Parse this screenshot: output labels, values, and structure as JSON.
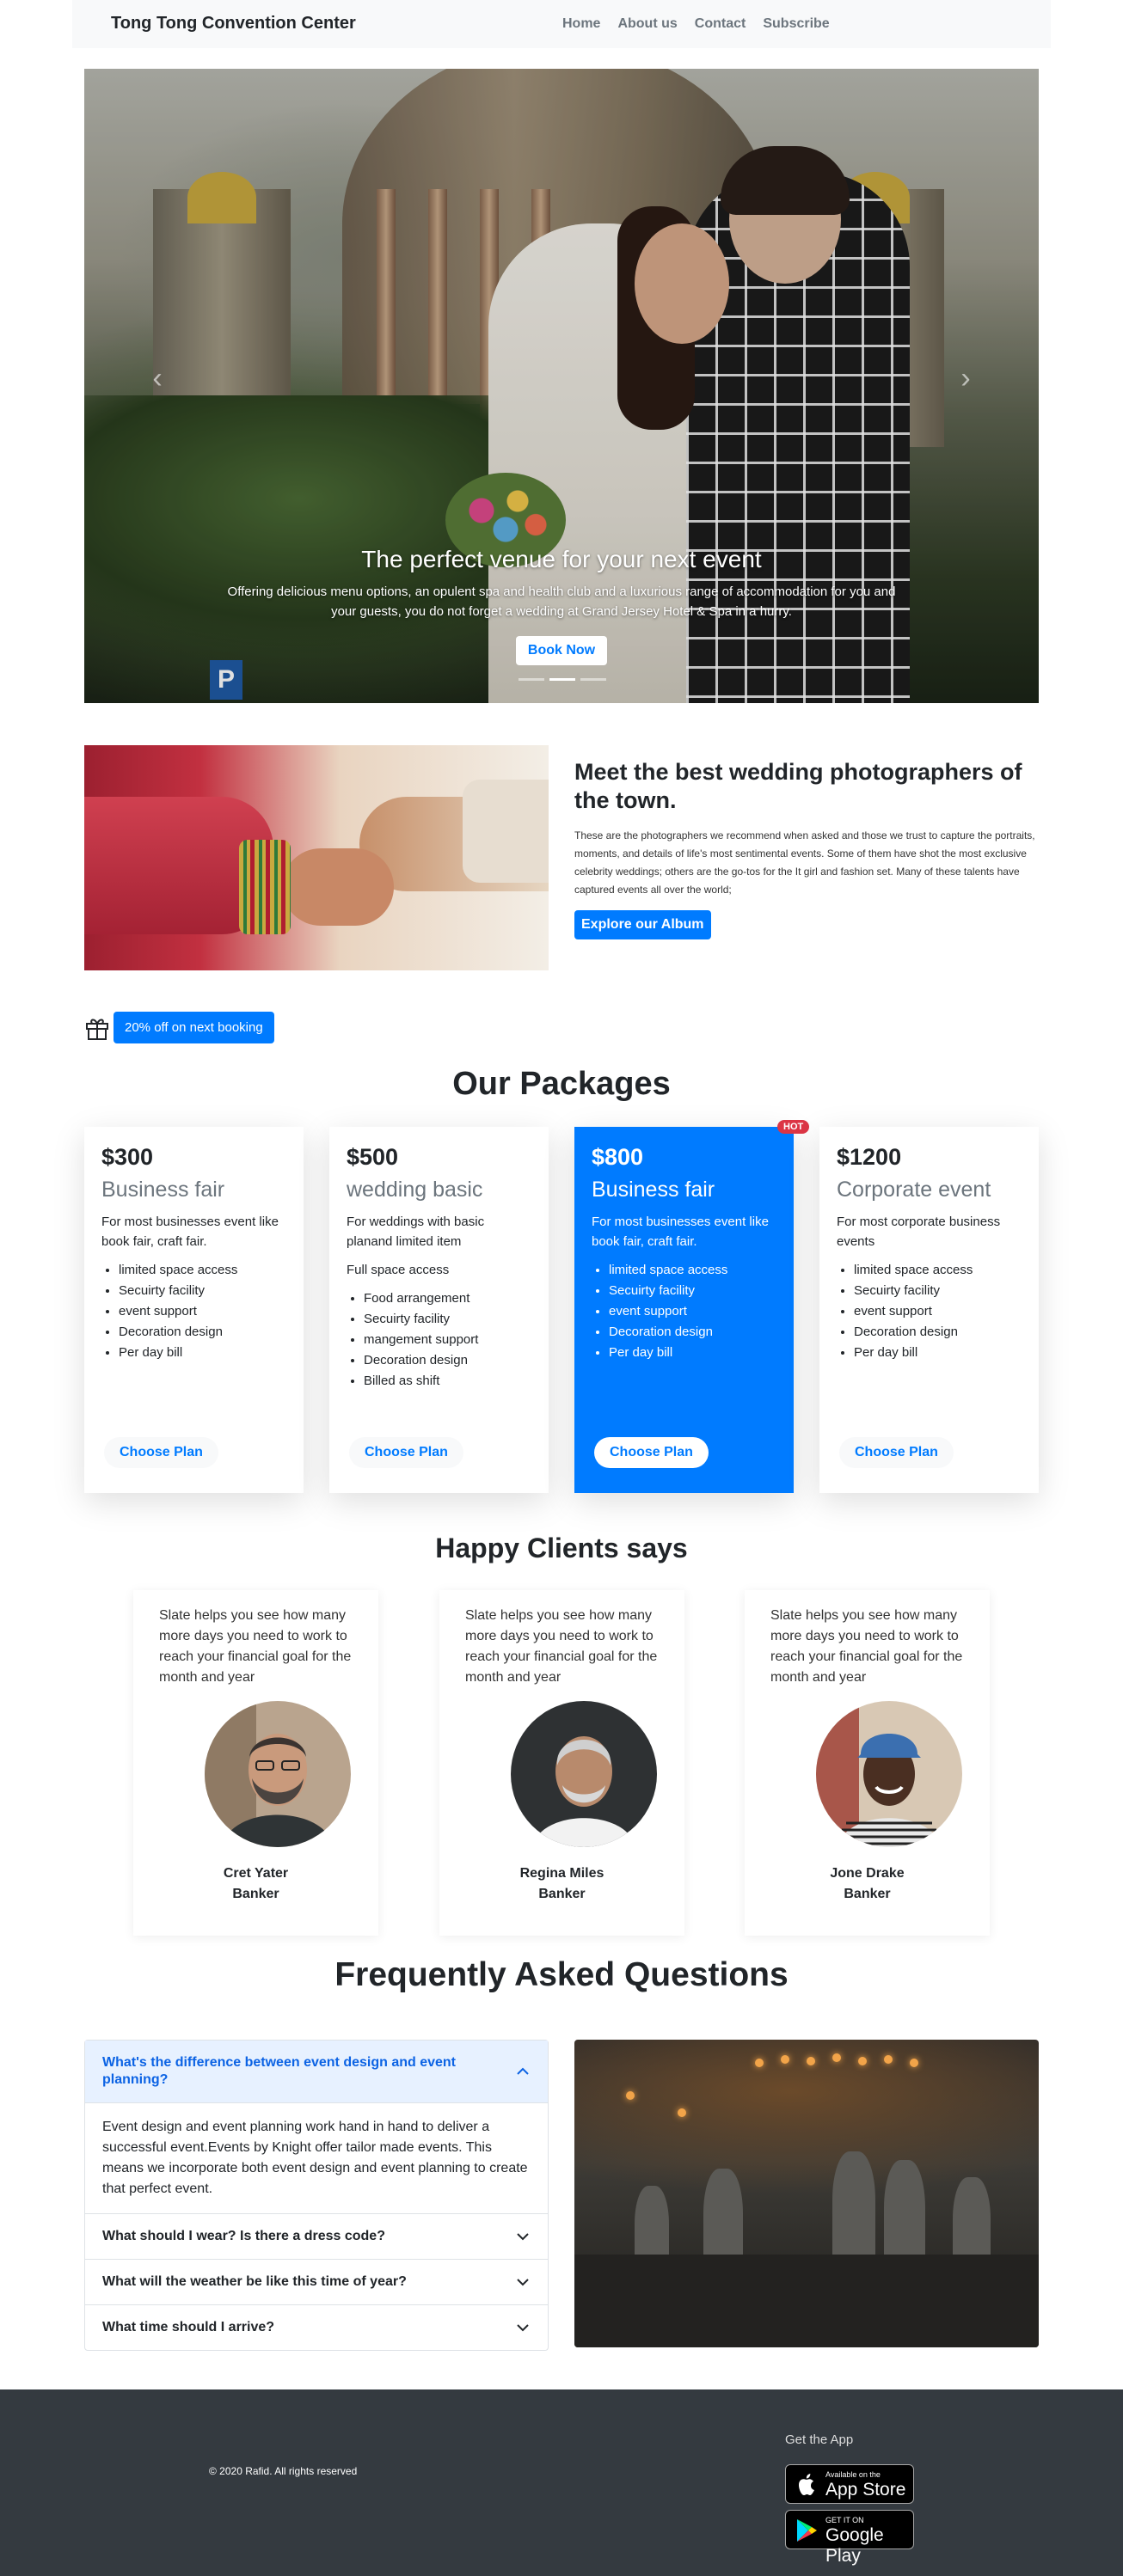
{
  "navbar": {
    "brand": "Tong Tong Convention Center",
    "links": [
      "Home",
      "About us",
      "Contact",
      "Subscribe"
    ]
  },
  "hero": {
    "title": "The perfect venue for your next event",
    "text": "Offering delicious menu options, an opulent spa and health club and a luxurious range of accommodation for you and your guests, you do not forget a wedding at Grand Jersey Hotel & Spa in a hurry.",
    "button": "Book Now",
    "parking_sign": "P",
    "prev": "‹",
    "next": "›",
    "slides": 3,
    "active_slide": 2
  },
  "photographers": {
    "title": "Meet the best wedding photographers of the town.",
    "text": "These are the photographers we recommend when asked and those we trust to capture the portraits, moments, and details of life's most sentimental events. Some of them have shot the most exclusive celebrity weddings; others are the go-tos for the It girl and fashion set. Many of these talents have captured events all over the world;",
    "button": "Explore our Album"
  },
  "promo": {
    "icon": "gift-icon",
    "label": "20% off on next booking"
  },
  "packages": {
    "title": "Our Packages",
    "hot_label": "HOT",
    "items": [
      {
        "price": "$300",
        "name": "Business fair",
        "desc": "For most businesses event like book fair, craft fair.",
        "lead": "",
        "features": [
          "limited space access",
          "Secuirty facility",
          "event support",
          "Decoration design",
          "Per day bill"
        ],
        "button": "Choose Plan"
      },
      {
        "price": "$500",
        "name": "wedding basic",
        "desc": "For weddings with basic planand limited item",
        "lead": "Full space access",
        "features": [
          "Food arrangement",
          "Secuirty facility",
          "mangement support",
          "Decoration design",
          "Billed as shift"
        ],
        "button": "Choose Plan"
      },
      {
        "price": "$800",
        "name": "Business fair",
        "desc": "For most businesses event like book fair, craft fair.",
        "lead": "",
        "features": [
          "limited space access",
          "Secuirty facility",
          "event support",
          "Decoration design",
          "Per day bill"
        ],
        "button": "Choose Plan"
      },
      {
        "price": "$1200",
        "name": "Corporate event",
        "desc": "For most corporate business events",
        "lead": "",
        "features": [
          "limited space access",
          "Secuirty facility",
          "event support",
          "Decoration design",
          "Per day bill"
        ],
        "button": "Choose Plan"
      }
    ]
  },
  "clients": {
    "title": "Happy Clients says",
    "items": [
      {
        "quote": "Slate helps you see how many more days you need to work to reach your financial goal for the month and year",
        "name": "Cret Yater",
        "role": "Banker"
      },
      {
        "quote": "Slate helps you see how many more days you need to work to reach your financial goal for the month and year",
        "name": "Regina Miles",
        "role": "Banker"
      },
      {
        "quote": "Slate helps you see how many more days you need to work to reach your financial goal for the month and year",
        "name": "Jone Drake",
        "role": "Banker"
      }
    ]
  },
  "faq": {
    "title": "Frequently Asked Questions",
    "items": [
      {
        "q": "What's the difference between event design and event planning?",
        "a": "Event design and event planning work hand in hand to deliver a successful event.Events by Knight offer tailor made events. This means we incorporate both event design and event planning to create that perfect event."
      },
      {
        "q": "What should I wear? Is there a dress code?"
      },
      {
        "q": "What will the weather be like this time of year?"
      },
      {
        "q": "What time should I arrive?"
      }
    ]
  },
  "footer": {
    "copyright": "© 2020 Rafid. All rights reserved",
    "get_app": "Get the App",
    "app_store_small": "Available on the",
    "app_store_big": "App Store",
    "google_small": "GET IT ON",
    "google_big": "Google Play"
  },
  "colors": {
    "primary": "#007bff",
    "hot": "#dc3545",
    "footer": "#343a40",
    "navbar": "#f8f9fa"
  }
}
